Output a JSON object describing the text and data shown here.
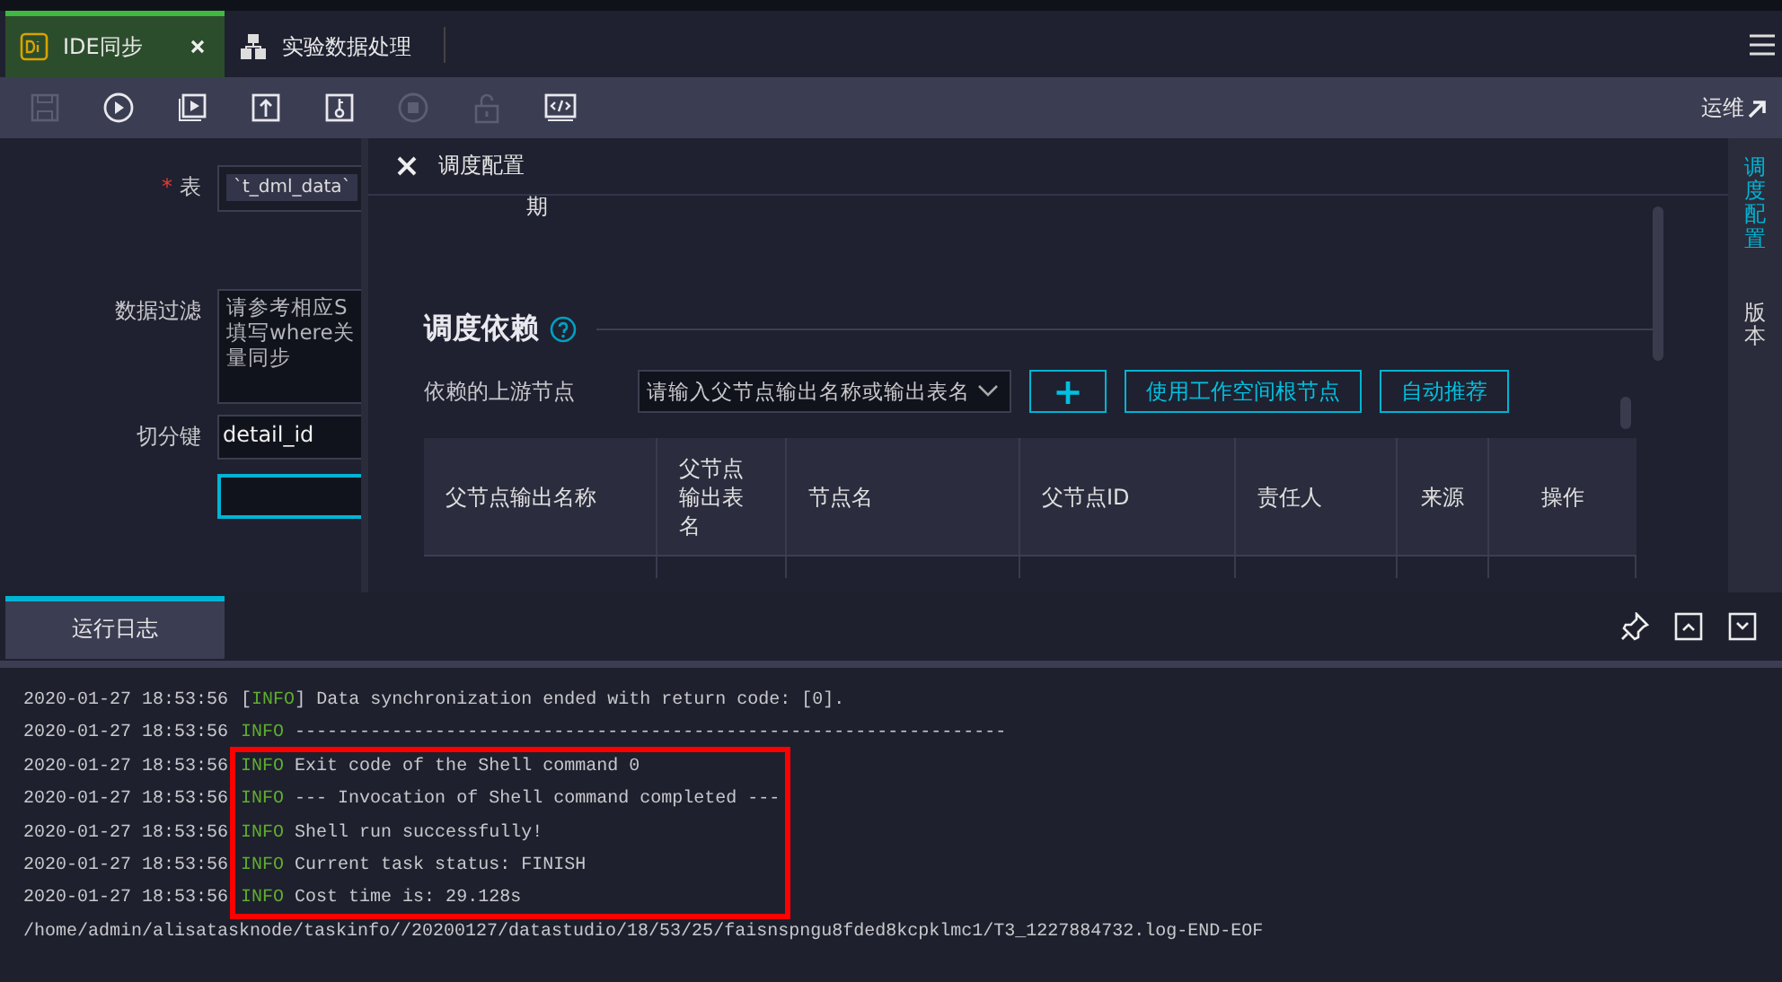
{
  "tabs": [
    {
      "label": "IDE同步",
      "kind": "di",
      "selected": true,
      "closable": true
    },
    {
      "label": "实验数据处理",
      "kind": "flow",
      "selected": false,
      "closable": false
    }
  ],
  "toolbar": {
    "tools": [
      {
        "kind": "save",
        "disabled": true
      },
      {
        "kind": "run",
        "disabled": false
      },
      {
        "kind": "run-params",
        "disabled": false
      },
      {
        "kind": "submit",
        "disabled": false
      },
      {
        "kind": "publish",
        "disabled": false
      },
      {
        "kind": "stop",
        "disabled": true
      },
      {
        "kind": "lock",
        "disabled": true
      },
      {
        "kind": "code",
        "disabled": false
      }
    ],
    "ops_link": "运维"
  },
  "form": {
    "fields": [
      {
        "label": "表",
        "required_mark": "*",
        "kind": "select",
        "value": "`t_dml_data`",
        "focused": false
      },
      {
        "label": "数据过滤",
        "kind": "textarea",
        "placeholder": "请参考相应S填写where关量同步",
        "focused": false
      },
      {
        "label": "切分键",
        "kind": "input",
        "value": "detail_id",
        "focused": false
      },
      {
        "kind": "input",
        "focused": true
      }
    ]
  },
  "panel": {
    "title": "调度配置",
    "partial_text": "期",
    "section": {
      "title": "调度依赖",
      "upstream_label": "依赖的上游节点",
      "upstream_placeholder": "请输入父节点输出名称或输出表名",
      "add_button": "+",
      "buttons": [
        "使用工作空间根节点",
        "自动推荐"
      ],
      "table": {
        "columns": [
          "父节点输出名称",
          "父节点输出表名",
          "节点名",
          "父节点ID",
          "责任人",
          "来源",
          "操作"
        ]
      }
    }
  },
  "side_tabs": [
    {
      "label": "调度配置",
      "selected": true
    },
    {
      "label": "版本",
      "selected": false
    }
  ],
  "log": {
    "tab": "运行日志",
    "lines": [
      {
        "kind": "entry",
        "time": "2020-01-27 18:53:56",
        "open": "[",
        "level": "INFO",
        "close": "]",
        "message": "Data synchronization ended with return code: [0]."
      },
      {
        "kind": "entry",
        "time": "2020-01-27 18:53:56",
        "level": "INFO",
        "message": "------------------------------------------------------------------"
      },
      {
        "kind": "entry",
        "time": "2020-01-27 18:53:56",
        "level": "INFO",
        "message": "Exit code of the Shell command 0"
      },
      {
        "kind": "entry",
        "time": "2020-01-27 18:53:56",
        "level": "INFO",
        "message": "--- Invocation of Shell command completed ---"
      },
      {
        "kind": "entry",
        "time": "2020-01-27 18:53:56",
        "level": "INFO",
        "message": "Shell run successfully!"
      },
      {
        "kind": "entry",
        "time": "2020-01-27 18:53:56",
        "level": "INFO",
        "message": "Current task status: FINISH"
      },
      {
        "kind": "entry",
        "time": "2020-01-27 18:53:56",
        "level": "INFO",
        "message": "Cost time is: 29.128s"
      },
      {
        "kind": "path",
        "text": "/home/admin/alisatasknode/taskinfo//20200127/datastudio/18/53/25/faisnspngu8fded8kcpklmc1/T3_1227884732.log-END-EOF"
      }
    ]
  }
}
